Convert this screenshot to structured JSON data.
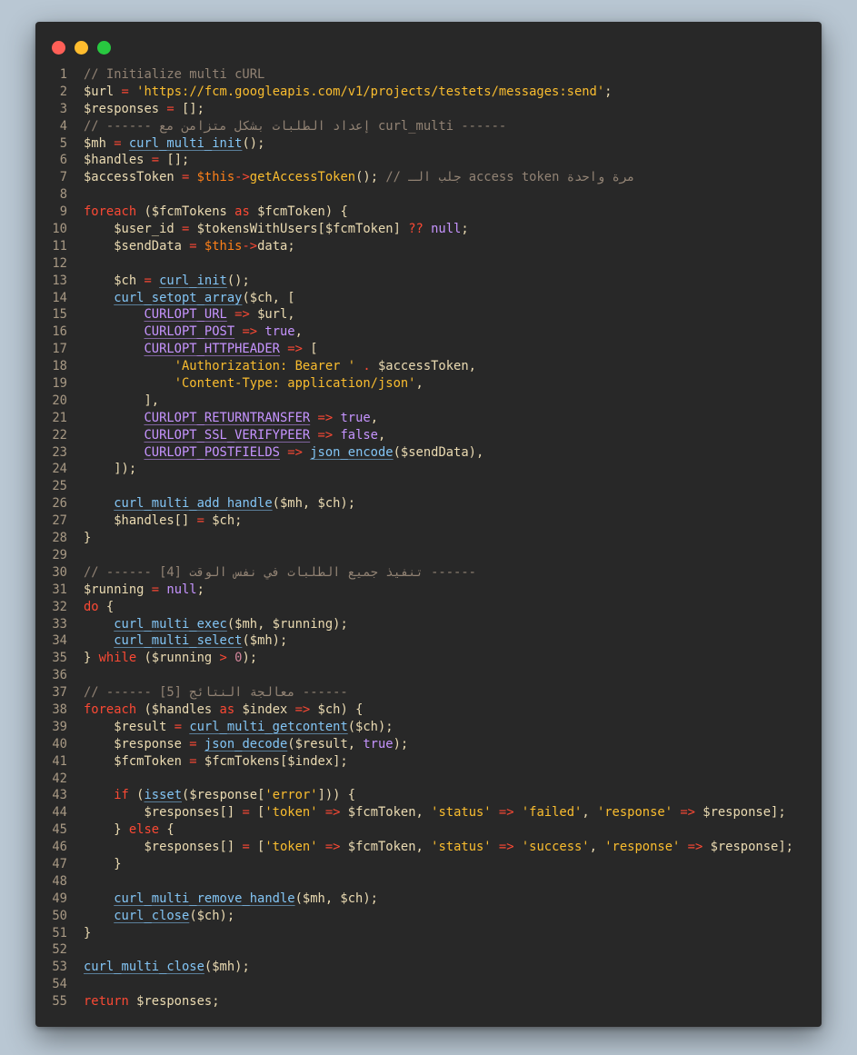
{
  "window": {
    "buttons": [
      "close",
      "minimize",
      "maximize"
    ]
  },
  "colors": {
    "background": "#b9c7d3",
    "editor_bg": "#282828",
    "comment": "#928374",
    "string": "#fabd2f",
    "operator": "#fb4934",
    "function": "#83c5f5",
    "constant": "#c694ff"
  },
  "code_lines": [
    [
      [
        "cm",
        "// Initialize multi cURL"
      ]
    ],
    [
      [
        "tx",
        "$url "
      ],
      [
        "op",
        "="
      ],
      [
        "tx",
        " "
      ],
      [
        "st",
        "'https://fcm.googleapis.com/v1/projects/testets/messages:send'"
      ],
      [
        "tx",
        ";"
      ]
    ],
    [
      [
        "tx",
        "$responses "
      ],
      [
        "op",
        "="
      ],
      [
        "tx",
        " [];"
      ]
    ],
    [
      [
        "cm",
        "// ------ إعداد الطلبات بشكل متزامن مع curl_multi ------"
      ]
    ],
    [
      [
        "tx",
        "$mh "
      ],
      [
        "op",
        "="
      ],
      [
        "tx",
        " "
      ],
      [
        "fn",
        "curl_multi_init"
      ],
      [
        "tx",
        "();"
      ]
    ],
    [
      [
        "tx",
        "$handles "
      ],
      [
        "op",
        "="
      ],
      [
        "tx",
        " [];"
      ]
    ],
    [
      [
        "tx",
        "$accessToken "
      ],
      [
        "op",
        "="
      ],
      [
        "tx",
        " "
      ],
      [
        "th",
        "$this"
      ],
      [
        "op",
        "->"
      ],
      [
        "me",
        "getAccessToken"
      ],
      [
        "tx",
        "(); "
      ],
      [
        "cm",
        "// جلب الـ access token مرة واحدة"
      ]
    ],
    [],
    [
      [
        "kw",
        "foreach"
      ],
      [
        "tx",
        " ($fcmTokens "
      ],
      [
        "kw",
        "as"
      ],
      [
        "tx",
        " $fcmToken) {"
      ]
    ],
    [
      [
        "tx",
        "    $user_id "
      ],
      [
        "op",
        "="
      ],
      [
        "tx",
        " $tokensWithUsers[$fcmToken] "
      ],
      [
        "op",
        "??"
      ],
      [
        "tx",
        " "
      ],
      [
        "bl",
        "null"
      ],
      [
        "tx",
        ";"
      ]
    ],
    [
      [
        "tx",
        "    $sendData "
      ],
      [
        "op",
        "="
      ],
      [
        "tx",
        " "
      ],
      [
        "th",
        "$this"
      ],
      [
        "op",
        "->"
      ],
      [
        "tx",
        "data;"
      ]
    ],
    [],
    [
      [
        "tx",
        "    $ch "
      ],
      [
        "op",
        "="
      ],
      [
        "tx",
        " "
      ],
      [
        "fn",
        "curl_init"
      ],
      [
        "tx",
        "();"
      ]
    ],
    [
      [
        "tx",
        "    "
      ],
      [
        "fn",
        "curl_setopt_array"
      ],
      [
        "tx",
        "($ch, ["
      ]
    ],
    [
      [
        "tx",
        "        "
      ],
      [
        "co",
        "CURLOPT_URL"
      ],
      [
        "tx",
        " "
      ],
      [
        "op",
        "=>"
      ],
      [
        "tx",
        " $url,"
      ]
    ],
    [
      [
        "tx",
        "        "
      ],
      [
        "co",
        "CURLOPT_POST"
      ],
      [
        "tx",
        " "
      ],
      [
        "op",
        "=>"
      ],
      [
        "tx",
        " "
      ],
      [
        "bl",
        "true"
      ],
      [
        "tx",
        ","
      ]
    ],
    [
      [
        "tx",
        "        "
      ],
      [
        "co",
        "CURLOPT_HTTPHEADER"
      ],
      [
        "tx",
        " "
      ],
      [
        "op",
        "=>"
      ],
      [
        "tx",
        " ["
      ]
    ],
    [
      [
        "tx",
        "            "
      ],
      [
        "st",
        "'Authorization: Bearer '"
      ],
      [
        "tx",
        " "
      ],
      [
        "op",
        "."
      ],
      [
        "tx",
        " $accessToken,"
      ]
    ],
    [
      [
        "tx",
        "            "
      ],
      [
        "st",
        "'Content-Type: application/json'"
      ],
      [
        "tx",
        ","
      ]
    ],
    [
      [
        "tx",
        "        ],"
      ]
    ],
    [
      [
        "tx",
        "        "
      ],
      [
        "co",
        "CURLOPT_RETURNTRANSFER"
      ],
      [
        "tx",
        " "
      ],
      [
        "op",
        "=>"
      ],
      [
        "tx",
        " "
      ],
      [
        "bl",
        "true"
      ],
      [
        "tx",
        ","
      ]
    ],
    [
      [
        "tx",
        "        "
      ],
      [
        "co",
        "CURLOPT_SSL_VERIFYPEER"
      ],
      [
        "tx",
        " "
      ],
      [
        "op",
        "=>"
      ],
      [
        "tx",
        " "
      ],
      [
        "bl",
        "false"
      ],
      [
        "tx",
        ","
      ]
    ],
    [
      [
        "tx",
        "        "
      ],
      [
        "co",
        "CURLOPT_POSTFIELDS"
      ],
      [
        "tx",
        " "
      ],
      [
        "op",
        "=>"
      ],
      [
        "tx",
        " "
      ],
      [
        "fn",
        "json_encode"
      ],
      [
        "tx",
        "($sendData),"
      ]
    ],
    [
      [
        "tx",
        "    ]);"
      ]
    ],
    [],
    [
      [
        "tx",
        "    "
      ],
      [
        "fn",
        "curl_multi_add_handle"
      ],
      [
        "tx",
        "($mh, $ch);"
      ]
    ],
    [
      [
        "tx",
        "    $handles[] "
      ],
      [
        "op",
        "="
      ],
      [
        "tx",
        " $ch;"
      ]
    ],
    [
      [
        "tx",
        "}"
      ]
    ],
    [],
    [
      [
        "cm",
        "// ------ [4] تنفيذ جميع الطلبات في نفس الوقت ------"
      ]
    ],
    [
      [
        "tx",
        "$running "
      ],
      [
        "op",
        "="
      ],
      [
        "tx",
        " "
      ],
      [
        "bl",
        "null"
      ],
      [
        "tx",
        ";"
      ]
    ],
    [
      [
        "kw",
        "do"
      ],
      [
        "tx",
        " {"
      ]
    ],
    [
      [
        "tx",
        "    "
      ],
      [
        "fn",
        "curl_multi_exec"
      ],
      [
        "tx",
        "($mh, $running);"
      ]
    ],
    [
      [
        "tx",
        "    "
      ],
      [
        "fn",
        "curl_multi_select"
      ],
      [
        "tx",
        "($mh);"
      ]
    ],
    [
      [
        "tx",
        "} "
      ],
      [
        "kw",
        "while"
      ],
      [
        "tx",
        " ($running "
      ],
      [
        "op",
        ">"
      ],
      [
        "tx",
        " "
      ],
      [
        "nu",
        "0"
      ],
      [
        "tx",
        ");"
      ]
    ],
    [],
    [
      [
        "cm",
        "// ------ [5] معالجة النتائج ------"
      ]
    ],
    [
      [
        "kw",
        "foreach"
      ],
      [
        "tx",
        " ($handles "
      ],
      [
        "kw",
        "as"
      ],
      [
        "tx",
        " $index "
      ],
      [
        "op",
        "=>"
      ],
      [
        "tx",
        " $ch) {"
      ]
    ],
    [
      [
        "tx",
        "    $result "
      ],
      [
        "op",
        "="
      ],
      [
        "tx",
        " "
      ],
      [
        "fn",
        "curl_multi_getcontent"
      ],
      [
        "tx",
        "($ch);"
      ]
    ],
    [
      [
        "tx",
        "    $response "
      ],
      [
        "op",
        "="
      ],
      [
        "tx",
        " "
      ],
      [
        "fn",
        "json_decode"
      ],
      [
        "tx",
        "($result, "
      ],
      [
        "bl",
        "true"
      ],
      [
        "tx",
        ");"
      ]
    ],
    [
      [
        "tx",
        "    $fcmToken "
      ],
      [
        "op",
        "="
      ],
      [
        "tx",
        " $fcmTokens[$index];"
      ]
    ],
    [],
    [
      [
        "tx",
        "    "
      ],
      [
        "kw",
        "if"
      ],
      [
        "tx",
        " ("
      ],
      [
        "fn",
        "isset"
      ],
      [
        "tx",
        "($response["
      ],
      [
        "st",
        "'error'"
      ],
      [
        "tx",
        "])) {"
      ]
    ],
    [
      [
        "tx",
        "        $responses[] "
      ],
      [
        "op",
        "="
      ],
      [
        "tx",
        " ["
      ],
      [
        "st",
        "'token'"
      ],
      [
        "tx",
        " "
      ],
      [
        "op",
        "=>"
      ],
      [
        "tx",
        " $fcmToken, "
      ],
      [
        "st",
        "'status'"
      ],
      [
        "tx",
        " "
      ],
      [
        "op",
        "=>"
      ],
      [
        "tx",
        " "
      ],
      [
        "st",
        "'failed'"
      ],
      [
        "tx",
        ", "
      ],
      [
        "st",
        "'response'"
      ],
      [
        "tx",
        " "
      ],
      [
        "op",
        "=>"
      ],
      [
        "tx",
        " $response];"
      ]
    ],
    [
      [
        "tx",
        "    } "
      ],
      [
        "kw",
        "else"
      ],
      [
        "tx",
        " {"
      ]
    ],
    [
      [
        "tx",
        "        $responses[] "
      ],
      [
        "op",
        "="
      ],
      [
        "tx",
        " ["
      ],
      [
        "st",
        "'token'"
      ],
      [
        "tx",
        " "
      ],
      [
        "op",
        "=>"
      ],
      [
        "tx",
        " $fcmToken, "
      ],
      [
        "st",
        "'status'"
      ],
      [
        "tx",
        " "
      ],
      [
        "op",
        "=>"
      ],
      [
        "tx",
        " "
      ],
      [
        "st",
        "'success'"
      ],
      [
        "tx",
        ", "
      ],
      [
        "st",
        "'response'"
      ],
      [
        "tx",
        " "
      ],
      [
        "op",
        "=>"
      ],
      [
        "tx",
        " $response];"
      ]
    ],
    [
      [
        "tx",
        "    }"
      ]
    ],
    [],
    [
      [
        "tx",
        "    "
      ],
      [
        "fn",
        "curl_multi_remove_handle"
      ],
      [
        "tx",
        "($mh, $ch);"
      ]
    ],
    [
      [
        "tx",
        "    "
      ],
      [
        "fn",
        "curl_close"
      ],
      [
        "tx",
        "($ch);"
      ]
    ],
    [
      [
        "tx",
        "}"
      ]
    ],
    [],
    [
      [
        "fn",
        "curl_multi_close"
      ],
      [
        "tx",
        "($mh);"
      ]
    ],
    [],
    [
      [
        "kw",
        "return"
      ],
      [
        "tx",
        " $responses;"
      ]
    ]
  ]
}
